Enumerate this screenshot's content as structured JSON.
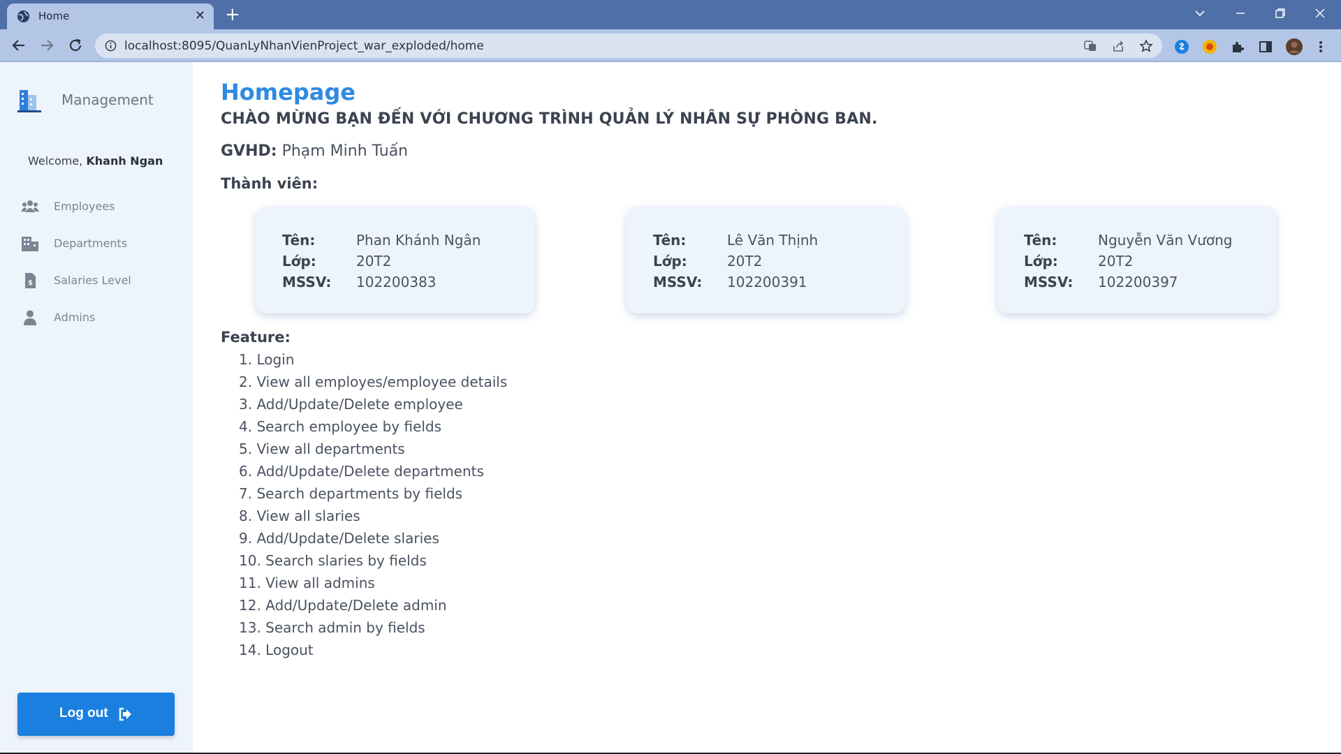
{
  "browser": {
    "tab_title": "Home",
    "tab_close": "✕",
    "new_tab": "+",
    "url": "localhost:8095/QuanLyNhanVienProject_war_exploded/home"
  },
  "sidebar": {
    "brand": "Management",
    "welcome_prefix": "Welcome, ",
    "welcome_user": "Khanh Ngan",
    "items": [
      {
        "label": "Employees",
        "icon": "users-icon"
      },
      {
        "label": "Departments",
        "icon": "building-icon"
      },
      {
        "label": "Salaries Level",
        "icon": "invoice-dollar-icon"
      },
      {
        "label": "Admins",
        "icon": "user-icon"
      }
    ],
    "logout_label": "Log out"
  },
  "main": {
    "title": "Homepage",
    "heading": "CHÀO MỪNG BẠN ĐẾN VỚI CHƯƠNG TRÌNH QUẢN LÝ NHÂN SỰ PHÒNG BAN.",
    "gvhd_label": "GVHD:",
    "gvhd_name": "Phạm Minh Tuấn",
    "members_label": "Thành viên:",
    "members": [
      {
        "ten_label": "Tên:",
        "ten": "Phan Khánh Ngân",
        "lop_label": "Lớp:",
        "lop": "20T2",
        "mssv_label": "MSSV:",
        "mssv": "102200383"
      },
      {
        "ten_label": "Tên:",
        "ten": "Lê Văn Thịnh",
        "lop_label": "Lớp:",
        "lop": "20T2",
        "mssv_label": "MSSV:",
        "mssv": "102200391"
      },
      {
        "ten_label": "Tên:",
        "ten": "Nguyễn Văn Vương",
        "lop_label": "Lớp:",
        "lop": "20T2",
        "mssv_label": "MSSV:",
        "mssv": "102200397"
      }
    ],
    "feature_label": "Feature:",
    "features": [
      "1. Login",
      "2. View all employes/employee details",
      "3. Add/Update/Delete employee",
      "4. Search employee by fields",
      "5. View all departments",
      "6. Add/Update/Delete departments",
      "7. Search departments by fields",
      "8. View all slaries",
      "9. Add/Update/Delete slaries",
      "10. Search slaries by fields",
      "11. View all admins",
      "12. Add/Update/Delete admin",
      "13. Search admin by fields",
      "14. Logout"
    ]
  },
  "colors": {
    "accent": "#1a7fde",
    "title": "#2f8ae0",
    "sidebar_bg": "#eef4fb",
    "chrome": "#4f6fa8"
  }
}
